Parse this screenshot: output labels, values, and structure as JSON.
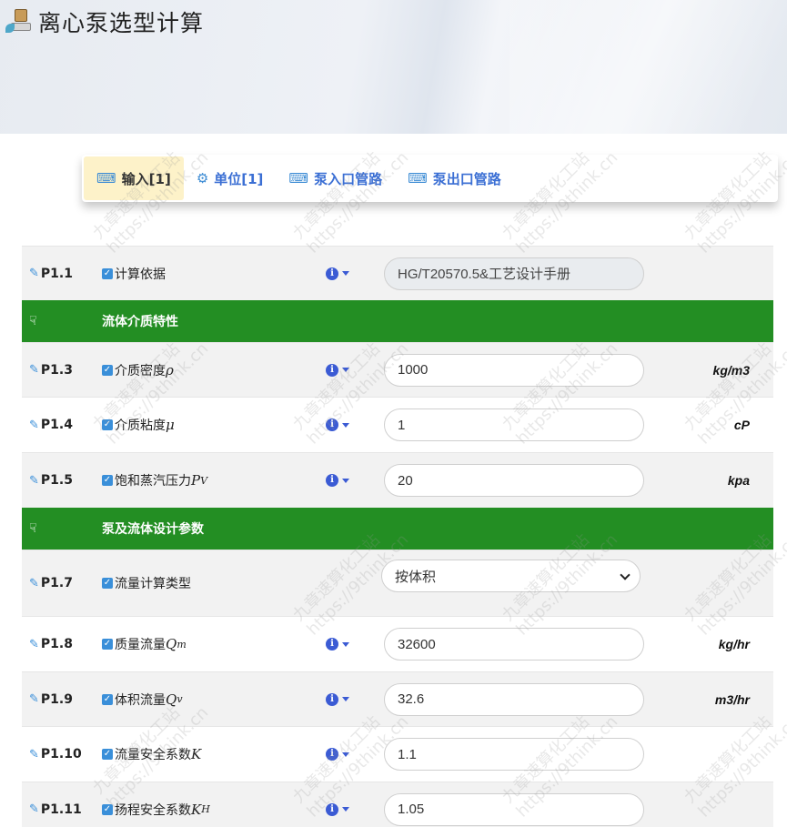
{
  "app": {
    "title": "离心泵选型计算",
    "icon": "computer-icon"
  },
  "tabs": [
    {
      "label": "输入[1]",
      "icon": "keyboard-icon",
      "active": true
    },
    {
      "label": "单位[1]",
      "icon": "gears-icon",
      "active": false
    },
    {
      "label": "泵入口管路",
      "icon": "keyboard-icon",
      "active": false
    },
    {
      "label": "泵出口管路",
      "icon": "keyboard-icon",
      "active": false
    }
  ],
  "rows": {
    "p1_1": {
      "id": "P1.1",
      "label": "计算依据",
      "value": "HG/T20570.5&工艺设计手册"
    },
    "section1": {
      "label": "流体介质特性"
    },
    "p1_3": {
      "id": "P1.3",
      "label": "介质密度",
      "symbol": "ρ",
      "value": "1000",
      "unit": "kg/m3"
    },
    "p1_4": {
      "id": "P1.4",
      "label": "介质粘度",
      "symbol": "μ",
      "value": "1",
      "unit": "cP"
    },
    "p1_5": {
      "id": "P1.5",
      "label": "饱和蒸汽压力",
      "symbol": "P",
      "sub": "V",
      "value": "20",
      "unit": "kpa"
    },
    "section2": {
      "label": "泵及流体设计参数"
    },
    "p1_7": {
      "id": "P1.7",
      "label": "流量计算类型",
      "value": "按体积"
    },
    "p1_8": {
      "id": "P1.8",
      "label": "质量流量",
      "symbol": "Q",
      "sub": "m",
      "value": "32600",
      "unit": "kg/hr"
    },
    "p1_9": {
      "id": "P1.9",
      "label": "体积流量",
      "symbol": "Q",
      "sub": "v",
      "value": "32.6",
      "unit": "m3/hr"
    },
    "p1_10": {
      "id": "P1.10",
      "label": "流量安全系数",
      "symbol": "K",
      "value": "1.1"
    },
    "p1_11": {
      "id": "P1.11",
      "label": "扬程安全系数",
      "symbol": "K",
      "sub": "H",
      "value": "1.05"
    }
  },
  "watermark": {
    "line1": "九章速算化工站",
    "line2": "https://9think.cn"
  },
  "colors": {
    "section_green": "#238e23",
    "link_blue": "#3b6fd4",
    "active_tab_bg": "#fdf2c9"
  }
}
